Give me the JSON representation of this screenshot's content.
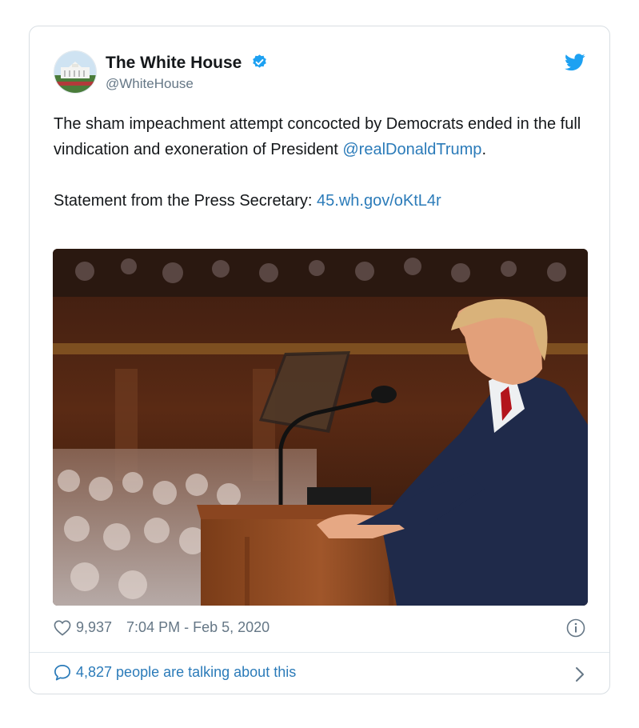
{
  "tweet": {
    "author_name": "The White House",
    "handle": "@WhiteHouse",
    "text_line1": "The sham impeachment attempt concocted by Democrats ended in the full vindication and exoneration of President ",
    "mention": "@realDonaldTrump",
    "text_after_mention": ".",
    "statement_label": "Statement from the Press Secretary: ",
    "link": "45.wh.gov/oKtL4r",
    "likes": "9,937",
    "time": "7:04 PM - Feb 5, 2020",
    "talking": "4,827 people are talking about this"
  },
  "icons": {
    "verified": "verified-badge-icon",
    "logo": "twitter-bird-icon",
    "like": "heart-icon",
    "info": "info-icon",
    "reply": "speech-bubble-icon",
    "chevron": "chevron-right-icon"
  },
  "colors": {
    "link": "#2b7bb9",
    "verified": "#1da1f2",
    "muted": "#657786"
  }
}
